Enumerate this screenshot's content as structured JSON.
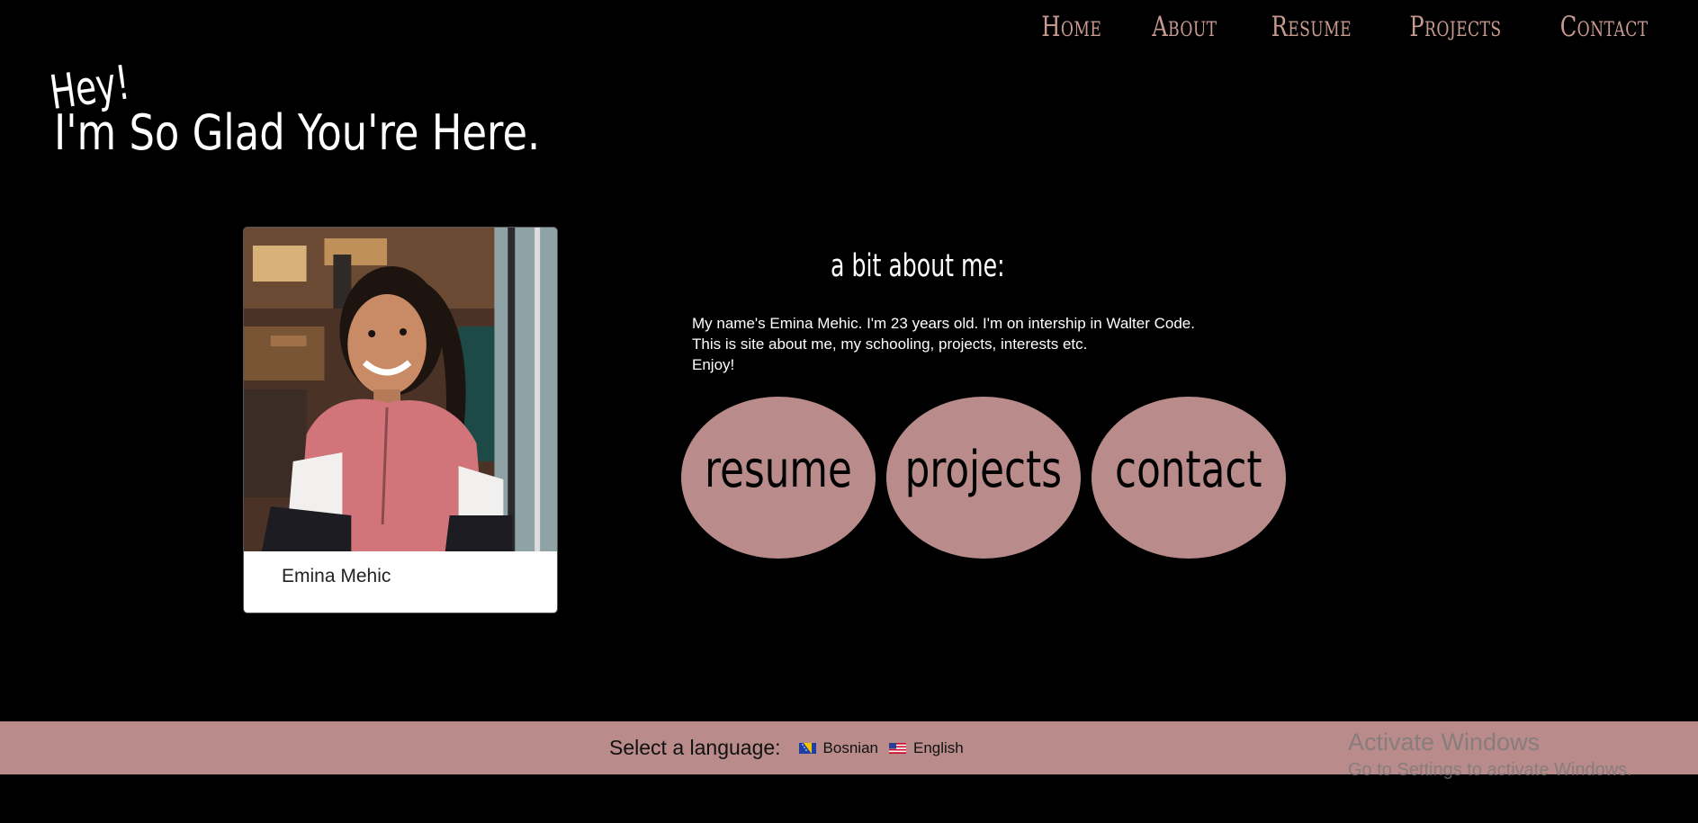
{
  "nav": {
    "items": [
      {
        "label": "Home"
      },
      {
        "label": "About"
      },
      {
        "label": "Resume"
      },
      {
        "label": "Projects"
      },
      {
        "label": "Contact"
      }
    ]
  },
  "hero": {
    "hey": "Hey!",
    "main": "I'm So Glad You're Here."
  },
  "profile": {
    "name": "Emina Mehic"
  },
  "about": {
    "title": "a bit about me:",
    "lines": [
      "My name's Emina Mehic. I'm 23 years old. I'm on intership in Walter Code.",
      "This is site about me, my schooling, projects, interests etc.",
      "Enjoy!"
    ]
  },
  "buttons": {
    "resume": "resume",
    "projects": "projects",
    "contact": "contact"
  },
  "language": {
    "label": "Select a language:",
    "options": [
      {
        "label": "Bosnian",
        "flag": "bosnia-flag-icon"
      },
      {
        "label": "English",
        "flag": "usa-flag-icon"
      }
    ]
  },
  "watermark": {
    "title": "Activate Windows",
    "subtitle": "Go to Settings to activate Windows."
  },
  "colors": {
    "background": "#000000",
    "nav_link": "#c99a90",
    "accent_pink": "#b98b8b",
    "text_light": "#ffffff"
  }
}
